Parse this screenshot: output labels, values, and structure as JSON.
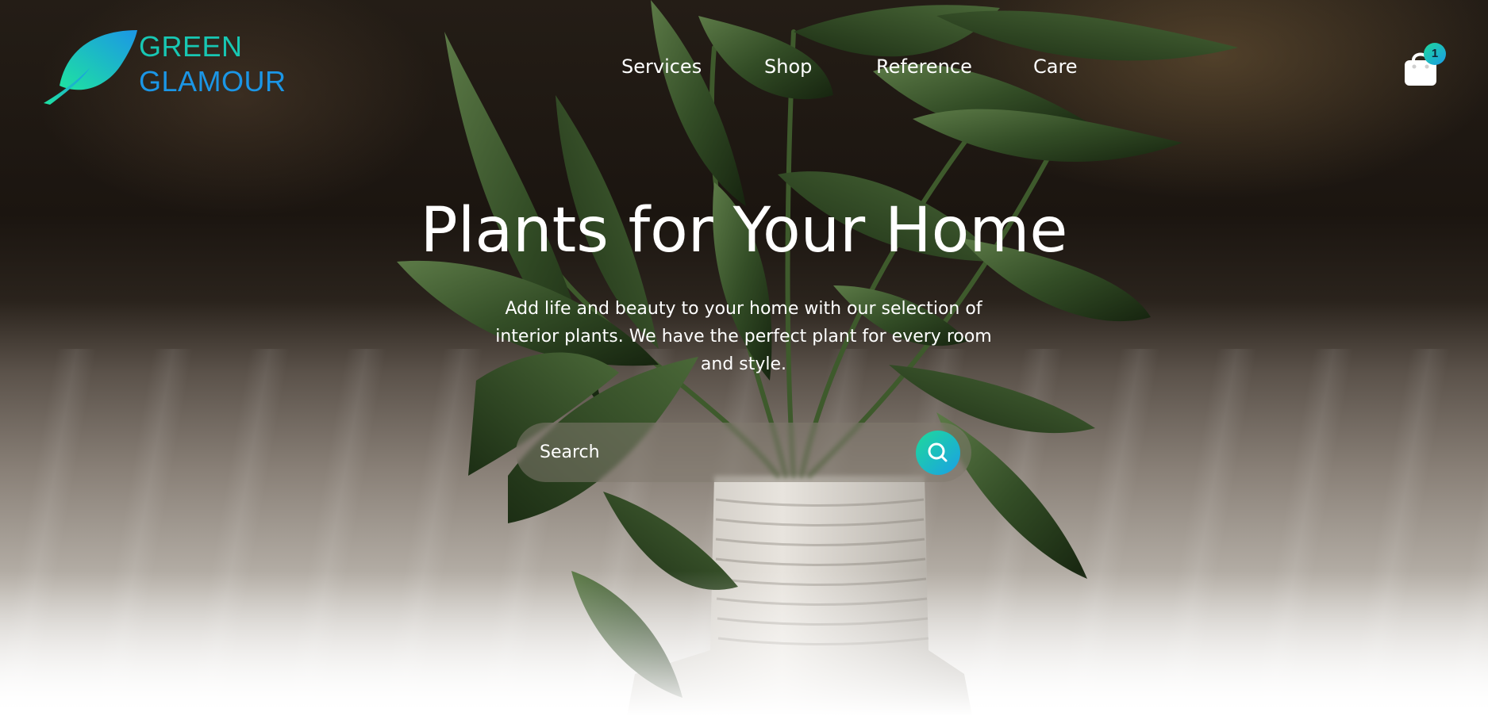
{
  "brand": {
    "line1": "GREEN",
    "line2": "GLAMOUR",
    "logo_icon": "leaf-icon",
    "gradient_start": "#1ee3a0",
    "gradient_end": "#1b96e6"
  },
  "nav": {
    "items": [
      {
        "label": "Services"
      },
      {
        "label": "Shop"
      },
      {
        "label": "Reference"
      },
      {
        "label": "Care"
      }
    ]
  },
  "cart": {
    "icon": "shopping-bag-icon",
    "count": "1"
  },
  "hero": {
    "title": "Plants for Your Home",
    "subtitle": "Add life and beauty to your home with our selection of interior plants. We have the perfect plant for every room and style."
  },
  "search": {
    "placeholder": "Search",
    "value": "",
    "button_icon": "search-icon"
  }
}
